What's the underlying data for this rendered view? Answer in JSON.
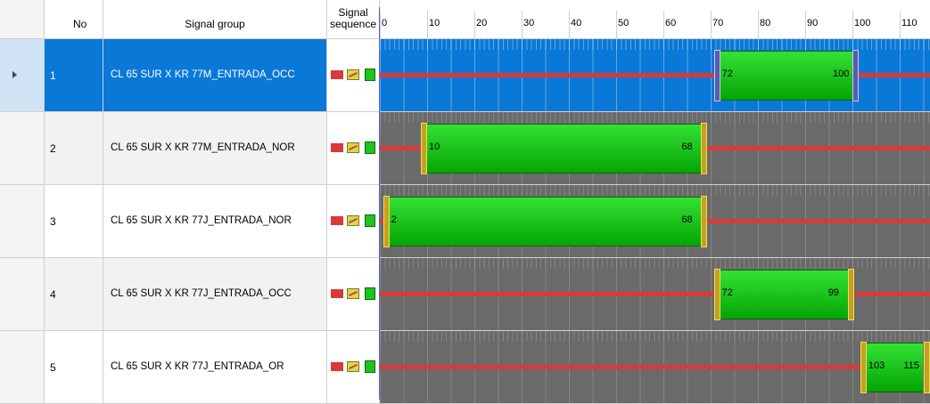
{
  "header": {
    "no_label": "No",
    "group_label": "Signal group",
    "seq_label_line1": "Signal",
    "seq_label_line2": "sequence",
    "ticks": [
      "0",
      "10",
      "20",
      "30",
      "40",
      "50",
      "60",
      "70",
      "80",
      "90",
      "100",
      "110"
    ]
  },
  "rows": [
    {
      "no": "1",
      "name": "CL 65 SUR X KR 77M_ENTRADA_OCC",
      "start": "72",
      "end": "100"
    },
    {
      "no": "2",
      "name": "CL 65 SUR X KR 77M_ENTRADA_NOR",
      "start": "10",
      "end": "68"
    },
    {
      "no": "3",
      "name": "CL 65 SUR X KR 77J_ENTRADA_NOR",
      "start": "2",
      "end": "68"
    },
    {
      "no": "4",
      "name": "CL 65 SUR X KR 77J_ENTRADA_OCC",
      "start": "72",
      "end": "99"
    },
    {
      "no": "5",
      "name": "CL 65 SUR X KR 77J_ENTRADA_OR",
      "start": "103",
      "end": "115"
    }
  ],
  "colors": {
    "selected": "#0a78d7",
    "green": "#1ec41e",
    "red": "#d83a3a"
  },
  "icons": [
    "row-pointer-icon",
    "red-signal-icon",
    "amber-signal-icon",
    "green-signal-icon"
  ]
}
